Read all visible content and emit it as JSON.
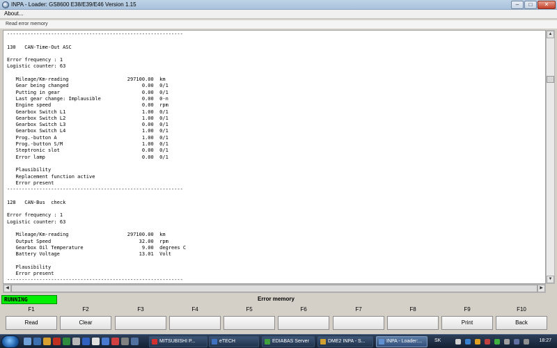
{
  "window": {
    "title": "INPA - Loader:  GS8600 E38/E39/E46 Version 1.15",
    "menu": "About...",
    "subheader": "Read error memory"
  },
  "content_lines": [
    "------------------------------------------------------------",
    "",
    "130   CAN-Time-Out ASC",
    "",
    "Error frequency : 1",
    "Logistic counter: 63",
    "",
    "   Mileage/Km-reading                    297100.00  km",
    "   Gear being changed                         0.00  0/1",
    "   Putting in gear                            0.00  0/1",
    "   Last gear change: Implausible              0.00  0-n",
    "   Engine speed                               0.00  rpm",
    "   Gearbox Switch L1                          1.00  0/1",
    "   Gearbox Switch L2                          1.00  0/1",
    "   Gearbox Switch L3                          0.00  0/1",
    "   Gearbox Switch L4                          1.00  0/1",
    "   Prog.-button A                             1.00  0/1",
    "   Prog.-button S/M                           1.00  0/1",
    "   Steptronic slot                            0.00  0/1",
    "   Error lamp                                 0.00  0/1",
    "",
    "   Plausibility",
    "   Replacement function active",
    "   Error present",
    "------------------------------------------------------------",
    "",
    "128   CAN-Bus  check",
    "",
    "Error frequency : 1",
    "Logistic counter: 63",
    "",
    "   Mileage/Km-reading                    297100.00  km",
    "   Output Speed                              32.00  rpm",
    "   Gearbox Oil Temperature                    9.00  degrees C",
    "   Battery Voltage                           13.01  Volt",
    "",
    "   Plausibility",
    "   Error present",
    "------------------------------------------------------------"
  ],
  "status": {
    "state": "RUNNING",
    "title": "Error memory",
    "state_color": "#00ee00"
  },
  "function_keys": [
    {
      "key": "F1",
      "label": "Read"
    },
    {
      "key": "F2",
      "label": "Clear"
    },
    {
      "key": "F3",
      "label": ""
    },
    {
      "key": "F4",
      "label": ""
    },
    {
      "key": "F5",
      "label": ""
    },
    {
      "key": "F6",
      "label": ""
    },
    {
      "key": "F7",
      "label": ""
    },
    {
      "key": "F8",
      "label": ""
    },
    {
      "key": "F9",
      "label": "Print"
    },
    {
      "key": "F10",
      "label": "Back"
    }
  ],
  "taskbar": {
    "tasks": [
      {
        "label": "MITSUBISHI P...",
        "active": false
      },
      {
        "label": "eTECH",
        "active": false
      },
      {
        "label": "EDIABAS Server",
        "active": false
      },
      {
        "label": "DME2 INPA - S...",
        "active": false
      },
      {
        "label": "INPA - Loader:...",
        "active": true
      }
    ],
    "language": "SK",
    "clock": "18:27"
  }
}
